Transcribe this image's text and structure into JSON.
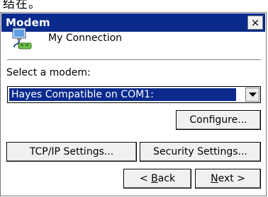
{
  "top_strip_text": "结在。",
  "window": {
    "title": "Modem",
    "close_glyph": "×"
  },
  "connection": {
    "name": "My Connection",
    "icon": "network-connection-icon"
  },
  "modem_select": {
    "label": "Select a modem:",
    "selected": "Hayes Compatible on COM1:"
  },
  "buttons": {
    "configure": "Configure...",
    "tcpip": "TCP/IP Settings...",
    "security": "Security Settings...",
    "back_prefix": "< ",
    "back_key": "B",
    "back_rest": "ack",
    "next_key": "N",
    "next_rest": "ext >"
  },
  "colors": {
    "titlebar": "#0a2a8c",
    "selection": "#0a2a8c"
  }
}
